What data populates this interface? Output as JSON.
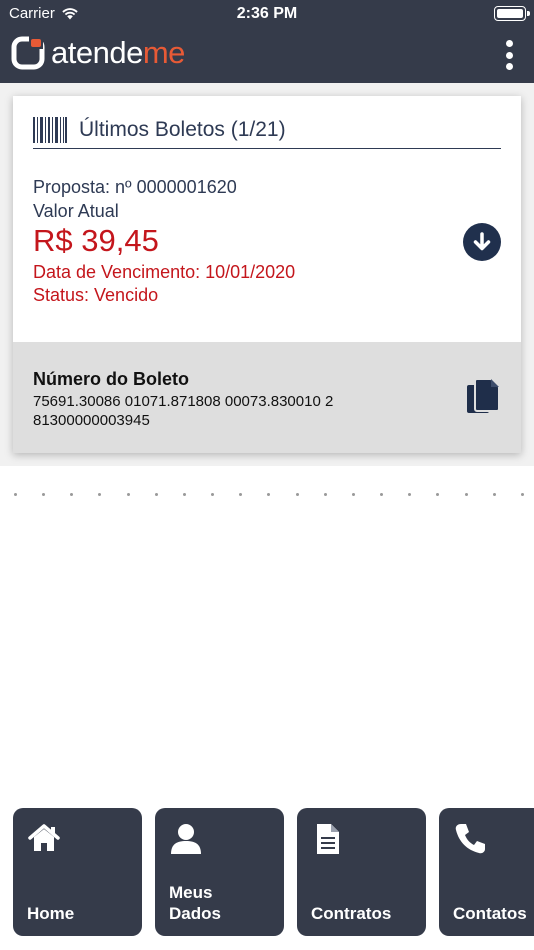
{
  "status_bar": {
    "carrier": "Carrier",
    "time": "2:36 PM"
  },
  "header": {
    "logo_main": "atende",
    "logo_accent": "me"
  },
  "card": {
    "title": "Últimos Boletos (1/21)",
    "proposal": "Proposta: nº 0000001620",
    "value_label": "Valor Atual",
    "value": "R$ 39,45",
    "due_date": "Data de Vencimento: 10/01/2020",
    "status": "Status: Vencido",
    "barcode_label": "Número do Boleto",
    "barcode_number": "75691.30086 01071.871808 00073.830010 2 81300000003945"
  },
  "colors": {
    "header_bg": "#353b4a",
    "accent": "#e75a36",
    "alert": "#c4161c",
    "navy": "#20304d"
  },
  "tiles": [
    {
      "label": "Home",
      "icon": "home-icon"
    },
    {
      "label": "Meus\nDados",
      "icon": "user-icon"
    },
    {
      "label": "Contratos",
      "icon": "document-icon"
    },
    {
      "label": "Contatos",
      "icon": "phone-icon"
    }
  ]
}
